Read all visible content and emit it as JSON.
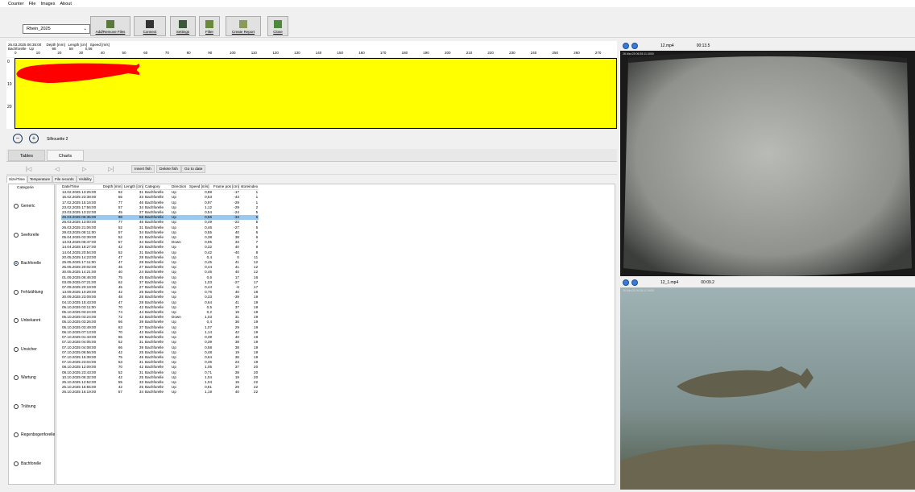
{
  "menu": [
    "Counter",
    "File",
    "Images",
    "About"
  ],
  "toolbar": {
    "location": "Rhein_2025",
    "buttons": [
      {
        "label": "Add/Remove Files",
        "icon": "table-icon"
      },
      {
        "label": "Connect",
        "icon": "plug-icon"
      },
      {
        "label": "Settings",
        "icon": "window-icon"
      },
      {
        "label": "Filter",
        "icon": "filter-icon"
      },
      {
        "label": "Create Report",
        "icon": "report-icon"
      },
      {
        "label": "Close",
        "icon": "door-icon"
      }
    ]
  },
  "depth_header": {
    "line1": "26.03.2025 06:35:00     Depth [mm]   Length [cm]   Speed [m/s]",
    "line2": "Bachforelle   Up                  98             58            0,56",
    "scale": [
      "0",
      "10",
      "20",
      "30",
      "40",
      "50",
      "60",
      "70",
      "80",
      "90",
      "100",
      "110",
      "120",
      "130",
      "140",
      "150",
      "160",
      "170",
      "180",
      "190",
      "200",
      "210",
      "220",
      "230",
      "240",
      "250",
      "260",
      "270"
    ],
    "y_ticks": [
      "0",
      "10",
      "20"
    ]
  },
  "silhouette_label": "Silhouette 2",
  "colors": {
    "plot_bg": "#ffff00",
    "fish": "#ff0000",
    "selected_row": "#99c9ef"
  },
  "tabs": [
    "Tables",
    "Charts"
  ],
  "nav": {
    "first": "|◁",
    "prev": "◁",
    "next": "▷",
    "last": "▷|"
  },
  "actions": [
    "Insert fish",
    "Delete fish",
    "Go to date"
  ],
  "subtabs": [
    "Size/Time",
    "Temperature",
    "File records",
    "Visibility"
  ],
  "categories_title": "Categorie",
  "categories": [
    {
      "label": "Generic",
      "selected": false
    },
    {
      "label": "Seeforelle",
      "selected": false
    },
    {
      "label": "Bachforelle",
      "selected": true
    },
    {
      "label": "Fehlzählung",
      "selected": false
    },
    {
      "label": "Unbekannt",
      "selected": false
    },
    {
      "label": "Unsicher",
      "selected": false
    },
    {
      "label": "Wartung",
      "selected": false
    },
    {
      "label": "Trübung",
      "selected": false
    },
    {
      "label": "Regenbogenforelle",
      "selected": false
    },
    {
      "label": "Bachforelle",
      "selected": false
    }
  ],
  "table": {
    "columns": [
      "Date/Time",
      "Depth [mm]",
      "Length [cm]",
      "Category",
      "Direction",
      "Speed [m/s]",
      "Frame pos [cm]",
      "storeindex"
    ],
    "selected_index": 5,
    "rows": [
      [
        "13.02.2025 13:26:00",
        "52",
        "31",
        "Bachforelle",
        "Up",
        "0,88",
        "-17",
        "1"
      ],
      [
        "15.02.2025 23:38:00",
        "55",
        "33",
        "Bachforelle",
        "Up",
        "0,53",
        "-43",
        "1"
      ],
      [
        "17.02.2025 15:16:00",
        "77",
        "46",
        "Bachforelle",
        "Up",
        "0,97",
        "-29",
        "1"
      ],
      [
        "23.02.2025 17:56:00",
        "57",
        "34",
        "Bachforelle",
        "Up",
        "1,12",
        "-29",
        "2"
      ],
      [
        "23.03.2025 13:22:00",
        "45",
        "27",
        "Bachforelle",
        "Up",
        "0,54",
        "-24",
        "5"
      ],
      [
        "26.03.2025 06:35:00",
        "98",
        "58",
        "Bachforelle",
        "Up",
        "0,56",
        "-34",
        "5"
      ],
      [
        "26.03.2025 13:00:00",
        "77",
        "46",
        "Bachforelle",
        "Up",
        "0,49",
        "-22",
        "5"
      ],
      [
        "26.03.2025 21:06:00",
        "52",
        "31",
        "Bachforelle",
        "Up",
        "0,46",
        "-27",
        "5"
      ],
      [
        "29.03.2025 08:11:00",
        "57",
        "34",
        "Bachforelle",
        "Up",
        "0,55",
        "40",
        "6"
      ],
      [
        "05.04.2025 03:39:00",
        "52",
        "31",
        "Bachforelle",
        "Up",
        "0,38",
        "38",
        "6"
      ],
      [
        "13.04.2025 06:47:00",
        "57",
        "34",
        "Bachforelle",
        "Down",
        "0,95",
        "33",
        "7"
      ],
      [
        "14.04.2025 18:27:00",
        "42",
        "25",
        "Bachforelle",
        "Up",
        "0,32",
        "40",
        "8"
      ],
      [
        "14.04.2025 20:54:00",
        "52",
        "31",
        "Bachforelle",
        "Up",
        "0,42",
        "-40",
        "8"
      ],
      [
        "20.05.2025 14:23:00",
        "47",
        "28",
        "Bachforelle",
        "Up",
        "0,4",
        "0",
        "11"
      ],
      [
        "25.05.2025 17:11:00",
        "47",
        "28",
        "Bachforelle",
        "Up",
        "0,45",
        "41",
        "12"
      ],
      [
        "25.05.2025 20:02:00",
        "45",
        "27",
        "Bachforelle",
        "Up",
        "0,44",
        "41",
        "12"
      ],
      [
        "30.05.2025 14:21:00",
        "40",
        "24",
        "Bachforelle",
        "Up",
        "0,46",
        "40",
        "12"
      ],
      [
        "01.09.2025 06:46:00",
        "75",
        "45",
        "Bachforelle",
        "Up",
        "0,6",
        "17",
        "16"
      ],
      [
        "03.09.2025 07:21:00",
        "62",
        "37",
        "Bachforelle",
        "Up",
        "1,03",
        "-27",
        "17"
      ],
      [
        "07.09.2025 20:19:00",
        "45",
        "27",
        "Bachforelle",
        "Up",
        "0,44",
        "-6",
        "17"
      ],
      [
        "13.09.2025 10:28:00",
        "42",
        "25",
        "Bachforelle",
        "Up",
        "0,76",
        "40",
        "18"
      ],
      [
        "30.09.2025 23:09:00",
        "48",
        "28",
        "Bachforelle",
        "Up",
        "0,33",
        "-39",
        "19"
      ],
      [
        "04.10.2025 15:43:00",
        "47",
        "28",
        "Bachforelle",
        "Up",
        "0,64",
        "41",
        "19"
      ],
      [
        "05.10.2025 03:11:00",
        "70",
        "42",
        "Bachforelle",
        "Up",
        "0,5",
        "37",
        "19"
      ],
      [
        "05.10.2025 03:24:00",
        "74",
        "44",
        "Bachforelle",
        "Up",
        "0,2",
        "19",
        "19"
      ],
      [
        "05.10.2025 03:24:00",
        "72",
        "43",
        "Bachforelle",
        "Down",
        "1,03",
        "31",
        "19"
      ],
      [
        "05.10.2025 03:26:00",
        "66",
        "39",
        "Bachforelle",
        "Up",
        "0,4",
        "36",
        "19"
      ],
      [
        "05.10.2025 03:49:00",
        "63",
        "37",
        "Bachforelle",
        "Up",
        "1,07",
        "29",
        "19"
      ],
      [
        "06.10.2025 07:13:00",
        "70",
        "42",
        "Bachforelle",
        "Up",
        "1,14",
        "42",
        "19"
      ],
      [
        "07.10.2025 01:43:00",
        "65",
        "39",
        "Bachforelle",
        "Up",
        "0,39",
        "40",
        "19"
      ],
      [
        "07.10.2025 04:05:00",
        "52",
        "31",
        "Bachforelle",
        "Up",
        "0,39",
        "38",
        "19"
      ],
      [
        "07.10.2025 04:08:00",
        "66",
        "39",
        "Bachforelle",
        "Up",
        "0,58",
        "38",
        "19"
      ],
      [
        "07.10.2025 06:56:00",
        "42",
        "25",
        "Bachforelle",
        "Up",
        "0,48",
        "19",
        "19"
      ],
      [
        "07.10.2025 15:39:00",
        "75",
        "45",
        "Bachforelle",
        "Up",
        "0,64",
        "36",
        "19"
      ],
      [
        "07.10.2025 23:04:00",
        "53",
        "31",
        "Bachforelle",
        "Up",
        "0,36",
        "23",
        "19"
      ],
      [
        "08.10.2025 12:09:00",
        "70",
        "42",
        "Bachforelle",
        "Up",
        "1,05",
        "37",
        "20"
      ],
      [
        "08.10.2025 23:43:00",
        "52",
        "31",
        "Bachforelle",
        "Up",
        "0,71",
        "38",
        "20"
      ],
      [
        "10.10.2025 05:32:00",
        "42",
        "25",
        "Bachforelle",
        "Up",
        "1,04",
        "19",
        "20"
      ],
      [
        "25.10.2025 12:52:00",
        "55",
        "33",
        "Bachforelle",
        "Up",
        "1,04",
        "15",
        "22"
      ],
      [
        "25.10.2025 15:55:00",
        "42",
        "25",
        "Bachforelle",
        "Up",
        "0,81",
        "29",
        "22"
      ],
      [
        "26.10.2025 16:19:00",
        "57",
        "34",
        "Bachforelle",
        "Up",
        "1,19",
        "40",
        "22"
      ]
    ]
  },
  "video1": {
    "file": "12.mp4",
    "time": "00:13.5",
    "stamp": "26.Mar.25 06:35:11.0000"
  },
  "video2": {
    "file": "12_1.mp4",
    "time": "00:09.2",
    "stamp": "26.Mar.25 06:35:11.0000"
  }
}
